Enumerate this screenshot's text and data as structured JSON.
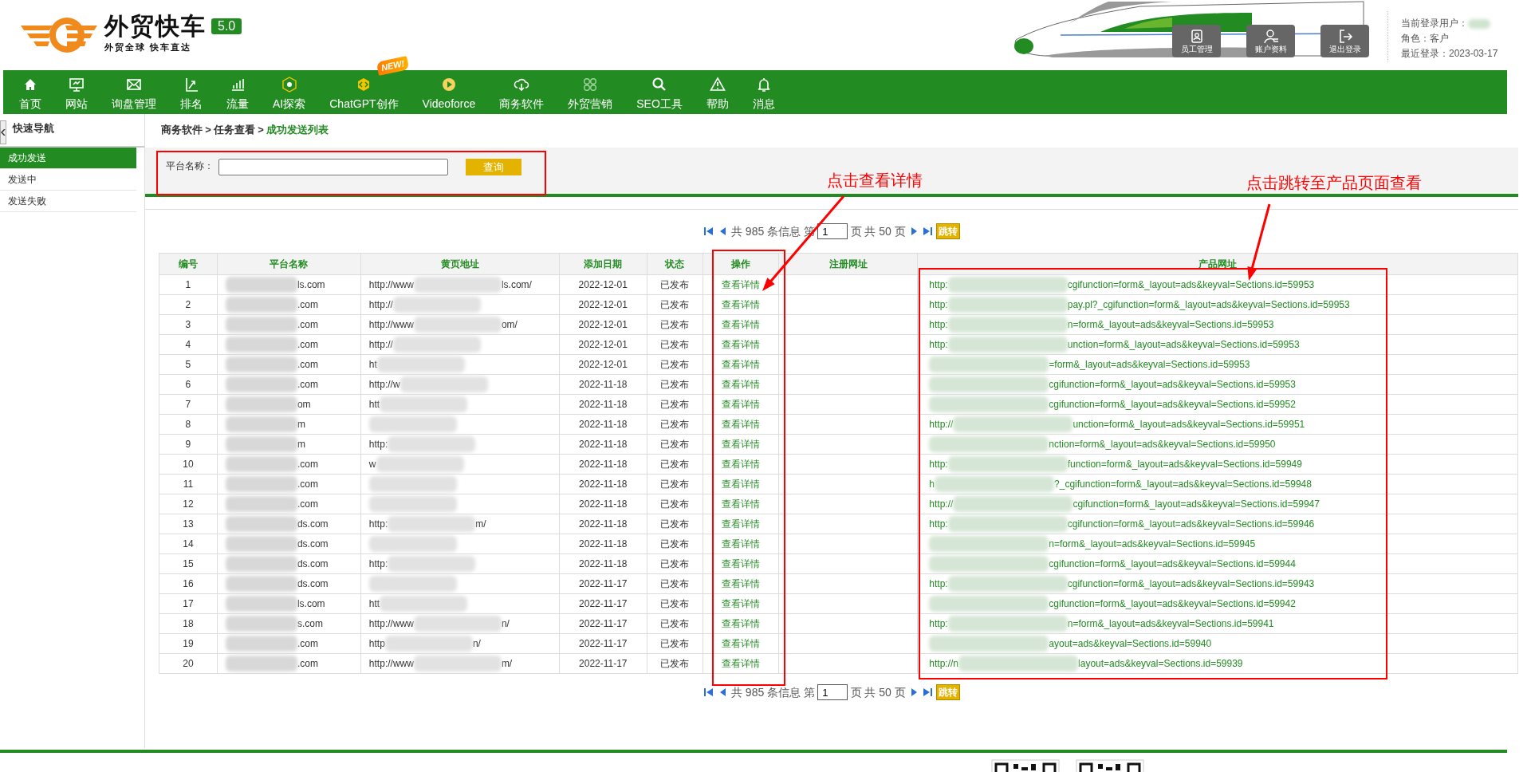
{
  "header": {
    "title": "外贸快车",
    "version": "5.0",
    "slogan": "外贸全球 快车直达",
    "buttons": [
      {
        "label": "员工管理",
        "kind": "staff"
      },
      {
        "label": "账户资料",
        "kind": "account"
      },
      {
        "label": "退出登录",
        "kind": "logout"
      }
    ],
    "user_label": "当前登录用户：",
    "role": "角色：客户",
    "last_login": "最近登录：2023-03-17"
  },
  "nav": [
    {
      "label": "首页",
      "kind": "home"
    },
    {
      "label": "网站",
      "kind": "monitor"
    },
    {
      "label": "询盘管理",
      "kind": "mail"
    },
    {
      "label": "排名",
      "kind": "rank"
    },
    {
      "label": "流量",
      "kind": "bars"
    },
    {
      "label": "AI探索",
      "kind": "ai"
    },
    {
      "label": "ChatGPT创作",
      "kind": "gpt",
      "badge": "NEW!"
    },
    {
      "label": "Videoforce",
      "kind": "video"
    },
    {
      "label": "商务软件",
      "kind": "cloud"
    },
    {
      "label": "外贸营销",
      "kind": "grid"
    },
    {
      "label": "SEO工具",
      "kind": "search"
    },
    {
      "label": "帮助",
      "kind": "warn"
    },
    {
      "label": "消息",
      "kind": "bell"
    }
  ],
  "sidebar": {
    "title": "快速导航",
    "items": [
      {
        "label": "成功发送",
        "selected": true
      },
      {
        "label": "发送中",
        "selected": false
      },
      {
        "label": "发送失败",
        "selected": false
      }
    ]
  },
  "breadcrumb": {
    "items": [
      "商务软件",
      "任务查看",
      "成功发送列表"
    ],
    "separator": ">"
  },
  "search": {
    "label": "平台名称：",
    "button": "查询"
  },
  "pagination": [
    {
      "prefix": "共 985 条信息 第",
      "page": "1",
      "suffix": "页 共 50 页",
      "button": "跳转"
    },
    {
      "prefix": "共 985 条信息 第",
      "page": "1",
      "suffix": "页 共 50 页",
      "button": "跳转"
    }
  ],
  "table": {
    "columns": [
      "编号",
      "平台名称",
      "黄页地址",
      "添加日期",
      "状态",
      "操作",
      "注册网址",
      "产品网址"
    ],
    "rows": [
      {
        "no": "1",
        "name": "ls.com",
        "yp_start": "http://www",
        "yp_end": "ls.com/",
        "date": "2022-12-01",
        "status": "已发布",
        "action": "查看详情",
        "url_start": "http:",
        "url_end": "cgifunction=form&_layout=ads&keyval=Sections.id=59953"
      },
      {
        "no": "2",
        "name": ".com",
        "yp_start": "http://",
        "date": "2022-12-01",
        "status": "已发布",
        "action": "查看详情",
        "url_start": "http:",
        "url_end": "pay.pl?_cgifunction=form&_layout=ads&keyval=Sections.id=59953"
      },
      {
        "no": "3",
        "name": ".com",
        "yp_start": "http://www",
        "yp_end": "om/",
        "date": "2022-12-01",
        "status": "已发布",
        "action": "查看详情",
        "url_start": "http:",
        "url_end": "n=form&_layout=ads&keyval=Sections.id=59953"
      },
      {
        "no": "4",
        "name": ".com",
        "yp_start": "http://",
        "date": "2022-12-01",
        "status": "已发布",
        "action": "查看详情",
        "url_start": "http:",
        "url_end": "unction=form&_layout=ads&keyval=Sections.id=59953"
      },
      {
        "no": "5",
        "name": ".com",
        "yp_start": "ht",
        "date": "2022-12-01",
        "status": "已发布",
        "action": "查看详情",
        "url_end": "=form&_layout=ads&keyval=Sections.id=59953"
      },
      {
        "no": "6",
        "name": ".com",
        "yp_start": "http://w",
        "date": "2022-11-18",
        "status": "已发布",
        "action": "查看详情",
        "url_end": "cgifunction=form&_layout=ads&keyval=Sections.id=59953"
      },
      {
        "no": "7",
        "name": "om",
        "yp_start": "htt",
        "date": "2022-11-18",
        "status": "已发布",
        "action": "查看详情",
        "url_end": "cgifunction=form&_layout=ads&keyval=Sections.id=59952"
      },
      {
        "no": "8",
        "name": "m",
        "date": "2022-11-18",
        "status": "已发布",
        "action": "查看详情",
        "url_start": "http://",
        "url_end": "unction=form&_layout=ads&keyval=Sections.id=59951"
      },
      {
        "no": "9",
        "name": "m",
        "yp_start": "http:",
        "date": "2022-11-18",
        "status": "已发布",
        "action": "查看详情",
        "url_end": "nction=form&_layout=ads&keyval=Sections.id=59950"
      },
      {
        "no": "10",
        "name": ".com",
        "yp_start": "w",
        "date": "2022-11-18",
        "status": "已发布",
        "action": "查看详情",
        "url_start": "http:",
        "url_end": "function=form&_layout=ads&keyval=Sections.id=59949"
      },
      {
        "no": "11",
        "name": ".com",
        "date": "2022-11-18",
        "status": "已发布",
        "action": "查看详情",
        "url_start": "h",
        "url_end": "?_cgifunction=form&_layout=ads&keyval=Sections.id=59948"
      },
      {
        "no": "12",
        "name": ".com",
        "date": "2022-11-18",
        "status": "已发布",
        "action": "查看详情",
        "url_start": "http://",
        "url_end": "cgifunction=form&_layout=ads&keyval=Sections.id=59947"
      },
      {
        "no": "13",
        "name": "ds.com",
        "yp_start": "http:",
        "yp_end": "m/",
        "date": "2022-11-18",
        "status": "已发布",
        "action": "查看详情",
        "url_start": "http:",
        "url_end": "cgifunction=form&_layout=ads&keyval=Sections.id=59946"
      },
      {
        "no": "14",
        "name": "ds.com",
        "date": "2022-11-18",
        "status": "已发布",
        "action": "查看详情",
        "url_end": "n=form&_layout=ads&keyval=Sections.id=59945"
      },
      {
        "no": "15",
        "name": "ds.com",
        "yp_start": "http:",
        "date": "2022-11-18",
        "status": "已发布",
        "action": "查看详情",
        "url_end": "cgifunction=form&_layout=ads&keyval=Sections.id=59944"
      },
      {
        "no": "16",
        "name": "ds.com",
        "date": "2022-11-17",
        "status": "已发布",
        "action": "查看详情",
        "url_start": "http:",
        "url_end": "cgifunction=form&_layout=ads&keyval=Sections.id=59943"
      },
      {
        "no": "17",
        "name": "ls.com",
        "yp_start": "htt",
        "date": "2022-11-17",
        "status": "已发布",
        "action": "查看详情",
        "url_end": "cgifunction=form&_layout=ads&keyval=Sections.id=59942"
      },
      {
        "no": "18",
        "name": "s.com",
        "yp_start": "http://www",
        "yp_end": "n/",
        "date": "2022-11-17",
        "status": "已发布",
        "action": "查看详情",
        "url_start": "http:",
        "url_end": "n=form&_layout=ads&keyval=Sections.id=59941"
      },
      {
        "no": "19",
        "name": ".com",
        "yp_start": "http",
        "yp_end": "n/",
        "date": "2022-11-17",
        "status": "已发布",
        "action": "查看详情",
        "url_end": "ayout=ads&keyval=Sections.id=59940"
      },
      {
        "no": "20",
        "name": ".com",
        "yp_start": "http://www",
        "yp_end": "m/",
        "date": "2022-11-17",
        "status": "已发布",
        "action": "查看详情",
        "url_start": "http://n",
        "url_end": "layout=ads&keyval=Sections.id=59939"
      }
    ]
  },
  "annotations": [
    {
      "text": "点击查看详情"
    },
    {
      "text": "点击跳转至产品页面查看"
    }
  ]
}
